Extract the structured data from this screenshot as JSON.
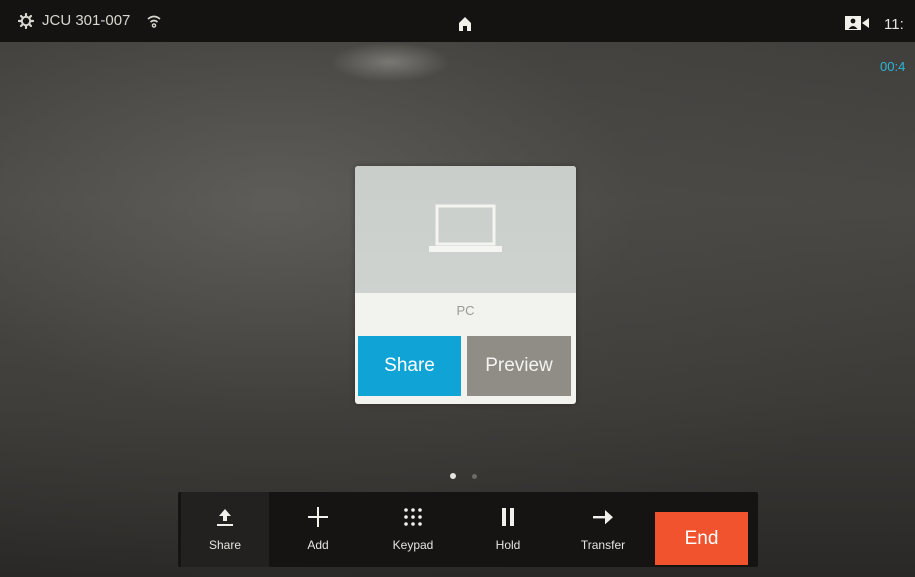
{
  "status_bar": {
    "room_name": "JCU 301-007",
    "clock": "11:",
    "icons": [
      "gear-icon",
      "wifi-icon",
      "home-icon",
      "camera-icon"
    ]
  },
  "call": {
    "duration": "00:4"
  },
  "share_card": {
    "source_label": "PC",
    "share_label": "Share",
    "preview_label": "Preview",
    "icon": "laptop-icon"
  },
  "pager": {
    "page_count": 2,
    "current_page": 1
  },
  "call_controls": {
    "share_label": "Share",
    "add_label": "Add",
    "keypad_label": "Keypad",
    "hold_label": "Hold",
    "transfer_label": "Transfer",
    "end_label": "End"
  },
  "colors": {
    "accent_blue": "#0fa3d6",
    "end_red": "#f0532e",
    "duration_text": "#2bb6da"
  }
}
